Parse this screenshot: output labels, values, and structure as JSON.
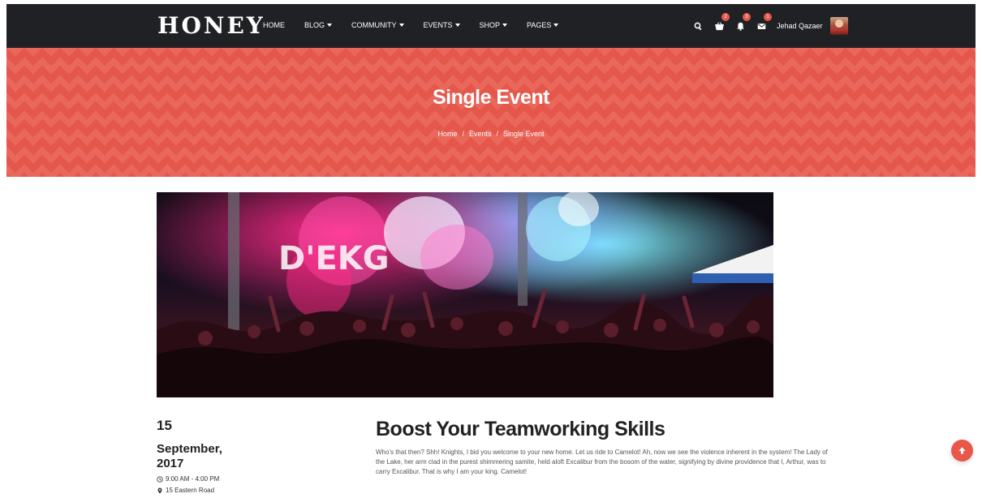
{
  "header": {
    "logo": "HONEY",
    "menu": [
      {
        "label": "HOME",
        "dropdown": false
      },
      {
        "label": "BLOG",
        "dropdown": true
      },
      {
        "label": "COMMUNITY",
        "dropdown": true
      },
      {
        "label": "EVENTS",
        "dropdown": true
      },
      {
        "label": "SHOP",
        "dropdown": true
      },
      {
        "label": "PAGES",
        "dropdown": true
      }
    ],
    "icons": {
      "search": "search-icon",
      "cart": {
        "icon": "cart-icon",
        "badge": "2"
      },
      "notifications": {
        "icon": "bell-icon",
        "badge": "3"
      },
      "messages": {
        "icon": "envelope-icon",
        "badge": "1"
      }
    },
    "user_name": "Jehad Qazaer"
  },
  "banner": {
    "title": "Single Event",
    "breadcrumb": [
      "Home",
      "Events",
      "Single Event"
    ],
    "color": "#e4574a"
  },
  "event": {
    "day": "15",
    "month_year": "September, 2017",
    "time": "9:00 AM - 4:00 PM",
    "location": "15 Eastern Road",
    "title": "Boost Your Teamworking Skills",
    "description": "Who's that then? Shh! Knights, I bid you welcome to your new home. Let us ride to Camelot! Ah, now we see the violence inherent in the system! The Lady of the Lake, her arm clad in the purest shimmering samite, held aloft Excalibur from the bosom of the water, signifying by divine providence that I, Arthur, was to carry Excalibur. That is why I am your king. Camelot!"
  },
  "accent_color": "#e8574a",
  "scroll_top_icon": "arrow-up-icon"
}
